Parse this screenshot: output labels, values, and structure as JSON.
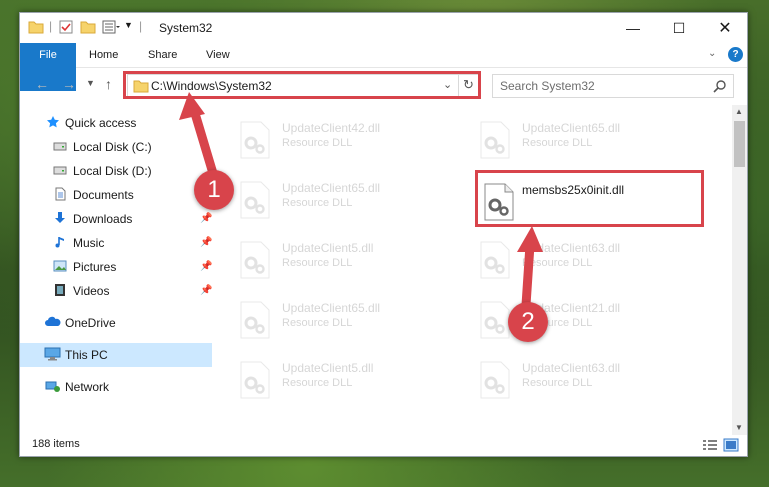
{
  "window": {
    "title": "System32",
    "ribbon_tabs": [
      "File",
      "Home",
      "Share",
      "View"
    ],
    "help": "?"
  },
  "nav": {
    "address": "C:\\Windows\\System32",
    "search_placeholder": "Search System32"
  },
  "sidebar": {
    "items": [
      {
        "label": "Quick access",
        "icon": "star-icon"
      },
      {
        "label": "Local Disk (C:)",
        "icon": "drive-icon"
      },
      {
        "label": "Local Disk (D:)",
        "icon": "drive-icon"
      },
      {
        "label": "Documents",
        "icon": "documents-icon"
      },
      {
        "label": "Downloads",
        "icon": "download-icon"
      },
      {
        "label": "Music",
        "icon": "music-icon"
      },
      {
        "label": "Pictures",
        "icon": "pictures-icon"
      },
      {
        "label": "Videos",
        "icon": "videos-icon"
      },
      {
        "label": "OneDrive",
        "icon": "cloud-icon"
      },
      {
        "label": "This PC",
        "icon": "computer-icon"
      },
      {
        "label": "Network",
        "icon": "network-icon"
      }
    ]
  },
  "files": [
    {
      "name": "UpdateClient42.dll",
      "type": "Resource DLL"
    },
    {
      "name": "UpdateClient65.dll",
      "type": "Resource DLL"
    },
    {
      "name": "UpdateClient65.dll",
      "type": "Resource DLL"
    },
    {
      "name": "memsbs25x0init.dll",
      "type": ""
    },
    {
      "name": "UpdateClient5.dll",
      "type": "Resource DLL"
    },
    {
      "name": "UpdateClient63.dll",
      "type": "Resource DLL"
    },
    {
      "name": "UpdateClient65.dll",
      "type": "Resource DLL"
    },
    {
      "name": "UpdateClient21.dll",
      "type": "Resource DLL"
    },
    {
      "name": "UpdateClient5.dll",
      "type": "Resource DLL"
    },
    {
      "name": "UpdateClient63.dll",
      "type": "Resource DLL"
    }
  ],
  "status": {
    "items_count": "188 items"
  },
  "annotations": {
    "step1": "1",
    "step2": "2",
    "callout_color": "#d8444b"
  }
}
